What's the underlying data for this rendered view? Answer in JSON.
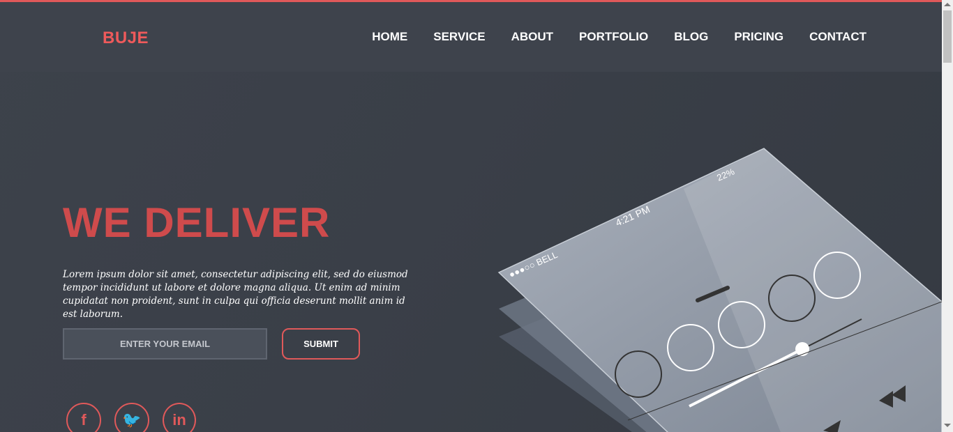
{
  "brand": {
    "logo": "BUJE",
    "accent": "#e0595a"
  },
  "nav": {
    "items": [
      "HOME",
      "SERVICE",
      "ABOUT",
      "PORTFOLIO",
      "BLOG",
      "PRICING",
      "CONTACT"
    ]
  },
  "hero": {
    "title": "WE DELIVER",
    "text": "Lorem ipsum dolor sit amet, consectetur adipiscing elit, sed do eiusmod tempor incididunt ut labore et dolore magna aliqua. Ut enim ad minim cupidatat non proident, sunt in culpa qui officia deserunt mollit anim id est laborum.",
    "email_placeholder": "ENTER YOUR EMAIL",
    "submit_label": "SUBMIT"
  },
  "social": {
    "icons": [
      "facebook-icon",
      "twitter-icon",
      "linkedin-icon"
    ],
    "glyphs": [
      "f",
      "🐦",
      "in"
    ]
  },
  "phone": {
    "carrier": "●●●○○ BELL",
    "time": "4:21 PM",
    "battery": "22%"
  }
}
